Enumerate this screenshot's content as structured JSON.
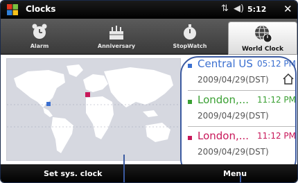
{
  "statusbar": {
    "title": "Clocks",
    "time": "5:12",
    "colors": {
      "bar": "#000000",
      "accent": "#ffffff"
    }
  },
  "tabs": [
    {
      "label": "Alarm",
      "icon": "alarm-clock-icon",
      "active": false
    },
    {
      "label": "Anniversary",
      "icon": "cake-icon",
      "active": false
    },
    {
      "label": "StopWatch",
      "icon": "stopwatch-icon",
      "active": false
    },
    {
      "label": "World Clock",
      "icon": "globe-clock-icon",
      "active": true
    }
  ],
  "map": {
    "icon": "world-map-icon"
  },
  "cities": [
    {
      "name": "Central US",
      "time": "05:12 PM",
      "date": "2009/04/29(DST)",
      "color": "#3a6fd0",
      "home": true
    },
    {
      "name": "London,...",
      "time": "11:12 PM",
      "date": "2009/04/29(DST)",
      "color": "#3aa033",
      "home": false
    },
    {
      "name": "London,...",
      "time": "11:12 PM",
      "date": "2009/04/29(DST)",
      "color": "#c8185a",
      "home": false
    }
  ],
  "softkeys": {
    "left": "Set sys. clock",
    "right": "Menu"
  }
}
